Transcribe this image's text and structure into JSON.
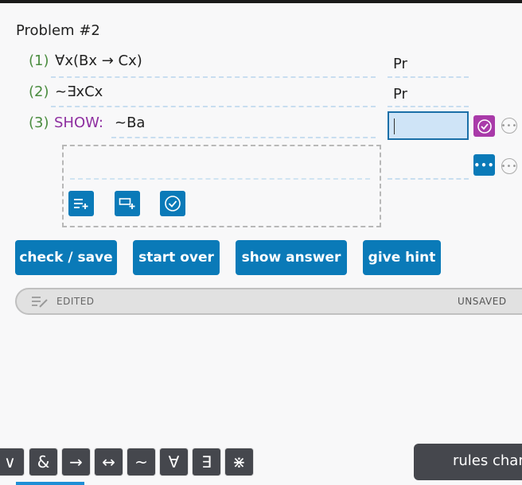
{
  "problem": {
    "title": "Problem #2"
  },
  "lines": [
    {
      "num": "(1)",
      "formula": "∀x(Bx → Cx)",
      "justification": "Pr"
    },
    {
      "num": "(2)",
      "formula": "~∃xCx",
      "justification": "Pr"
    },
    {
      "num": "(3)",
      "keyword": "SHOW:",
      "formula": "~Ba",
      "justification": ""
    }
  ],
  "colors": {
    "accent": "#0a7ab8",
    "show": "#8e2fa0",
    "line_number": "#4a8c3f",
    "check": "#a93aa9"
  },
  "buttons": {
    "check_save": "check / save",
    "start_over": "start over",
    "show_answer": "show answer",
    "give_hint": "give hint"
  },
  "status": {
    "left": "EDITED",
    "right": "UNSAVED"
  },
  "symbols": [
    "∨",
    "&",
    "→",
    "↔",
    "~",
    "∀",
    "∃",
    "⋇"
  ],
  "rules_button": "rules char"
}
